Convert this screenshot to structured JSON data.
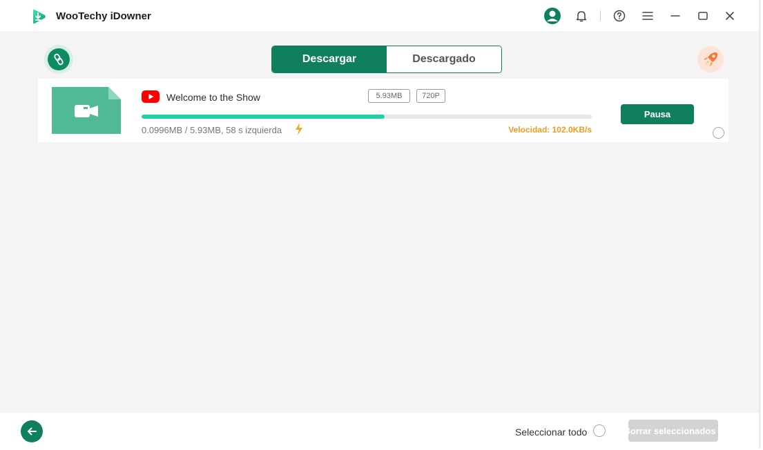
{
  "app": {
    "title": "WooTechy iDowner",
    "brand_color": "#0f7f5e",
    "accent_color": "#1fd1a4"
  },
  "titlebar": {
    "icons": [
      "account-icon",
      "bell-icon",
      "help-icon",
      "menu-icon",
      "minimize-icon",
      "maximize-icon",
      "close-icon"
    ]
  },
  "tabs": {
    "download_label": "Descargar",
    "downloaded_label": "Descargado",
    "active": "download"
  },
  "download_item": {
    "title": "Welcome to the Show",
    "source_icon": "youtube-icon",
    "size_badge": "5.93MB",
    "resolution_badge": "720P",
    "progress_fraction": 0.54,
    "progress_text": "0.0996MB / 5.93MB, 58 s izquierda",
    "speed_text": "Velocidad: 102.0KB/s",
    "speed_color": "#f29a1f",
    "pause_label": "Pausa"
  },
  "footer": {
    "select_all_label": "Seleccionar todo",
    "delete_selected_label": "Borrar seleccionados"
  }
}
